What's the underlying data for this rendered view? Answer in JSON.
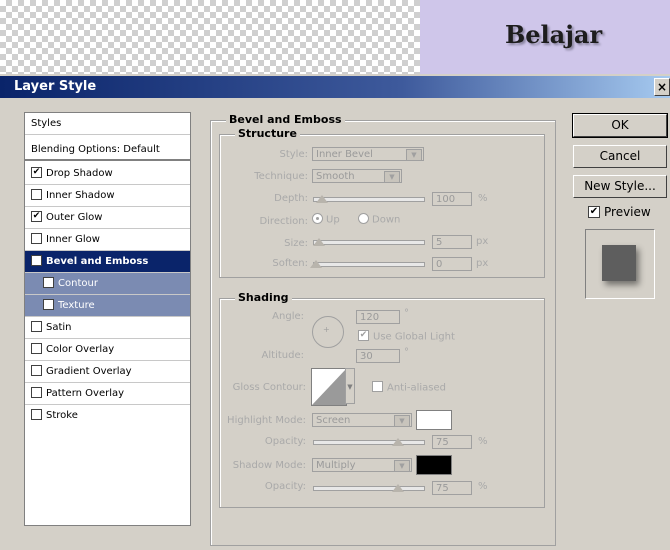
{
  "canvas": {
    "text": "Belajar"
  },
  "window": {
    "title": "Layer Style",
    "close_glyph": "×"
  },
  "styles_list": {
    "items": [
      {
        "label": "Styles"
      },
      {
        "label": "Blending Options: Default"
      },
      {
        "label": "Drop Shadow",
        "checked": true
      },
      {
        "label": "Inner Shadow",
        "checked": false
      },
      {
        "label": "Outer Glow",
        "checked": true
      },
      {
        "label": "Inner Glow",
        "checked": false
      },
      {
        "label": "Bevel and Emboss",
        "checked": false,
        "active": true
      },
      {
        "label": "Contour",
        "checked": false
      },
      {
        "label": "Texture",
        "checked": false
      },
      {
        "label": "Satin",
        "checked": false
      },
      {
        "label": "Color Overlay",
        "checked": false
      },
      {
        "label": "Gradient Overlay",
        "checked": false
      },
      {
        "label": "Pattern Overlay",
        "checked": false
      },
      {
        "label": "Stroke",
        "checked": false
      }
    ]
  },
  "panel": {
    "title": "Bevel and Emboss",
    "structure": {
      "title": "Structure",
      "style_label": "Style:",
      "style_value": "Inner Bevel",
      "technique_label": "Technique:",
      "technique_value": "Smooth",
      "depth_label": "Depth:",
      "depth_value": "100",
      "depth_unit": "%",
      "direction_label": "Direction:",
      "direction_up": "Up",
      "direction_down": "Down",
      "size_label": "Size:",
      "size_value": "5",
      "size_unit": "px",
      "soften_label": "Soften:",
      "soften_value": "0",
      "soften_unit": "px"
    },
    "shading": {
      "title": "Shading",
      "angle_label": "Angle:",
      "angle_value": "120",
      "angle_unit": "°",
      "global_light_label": "Use Global Light",
      "altitude_label": "Altitude:",
      "altitude_value": "30",
      "altitude_unit": "°",
      "gloss_label": "Gloss Contour:",
      "anti_aliased_label": "Anti-aliased",
      "highlight_mode_label": "Highlight Mode:",
      "highlight_mode_value": "Screen",
      "highlight_color": "#ffffff",
      "highlight_opacity_label": "Opacity:",
      "highlight_opacity_value": "75",
      "highlight_opacity_unit": "%",
      "shadow_mode_label": "Shadow Mode:",
      "shadow_mode_value": "Multiply",
      "shadow_color": "#000000",
      "shadow_opacity_label": "Opacity:",
      "shadow_opacity_value": "75",
      "shadow_opacity_unit": "%"
    }
  },
  "buttons": {
    "ok": "OK",
    "cancel": "Cancel",
    "new_style": "New Style...",
    "preview": "Preview"
  }
}
